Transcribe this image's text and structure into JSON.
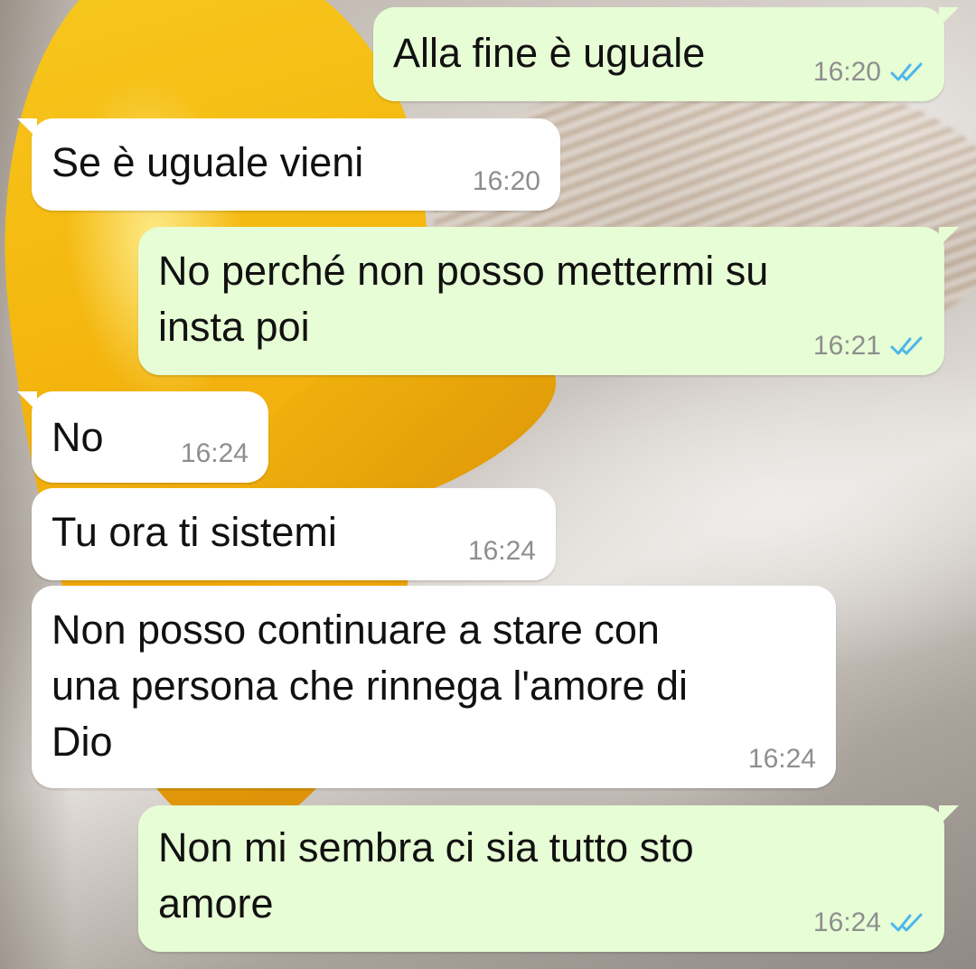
{
  "colors": {
    "outgoing_bubble": "#e7fdd5",
    "incoming_bubble": "#ffffff",
    "read_ticks": "#4fb6ec",
    "timestamp": "#8e8e8e"
  },
  "messages": [
    {
      "direction": "outgoing",
      "text": "Alla fine è uguale",
      "time": "16:20",
      "status_icon": "double-check-read-icon"
    },
    {
      "direction": "incoming",
      "text": "Se è uguale vieni",
      "time": "16:20"
    },
    {
      "direction": "outgoing",
      "text": "No perché non posso mettermi su\ninsta poi",
      "time": "16:21",
      "status_icon": "double-check-read-icon"
    },
    {
      "direction": "incoming",
      "text": "No",
      "time": "16:24"
    },
    {
      "direction": "incoming",
      "text": "Tu ora ti sistemi",
      "time": "16:24"
    },
    {
      "direction": "incoming",
      "text": "Non posso continuare a stare con\nuna persona che rinnega l'amore di\nDio",
      "time": "16:24"
    },
    {
      "direction": "outgoing",
      "text": "Non mi sembra ci sia tutto sto\namore",
      "time": "16:24",
      "status_icon": "double-check-read-icon"
    }
  ]
}
